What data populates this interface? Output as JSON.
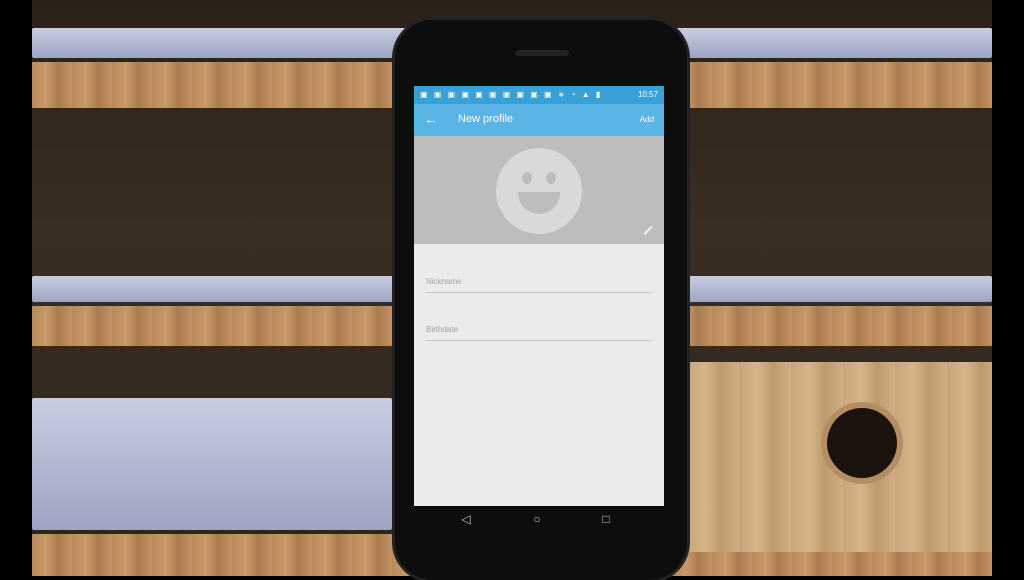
{
  "statusbar": {
    "icons": "▣ ▣ ▣ ▣ ▣ ▣ ▣ ▣ ▣ ▣  ∗ ◔ ▲ ▮",
    "time": "10:57"
  },
  "appbar": {
    "back_icon": "←",
    "title": "New profile",
    "action": "Add"
  },
  "form": {
    "nickname_placeholder": "Nickname",
    "birthdate_placeholder": "Birthdate"
  },
  "navbar": {
    "back": "◁",
    "home": "○",
    "recents": "□"
  },
  "colors": {
    "accent": "#5bb4e6",
    "statusbar": "#3aa0d8",
    "header": "#bdbdbd"
  }
}
